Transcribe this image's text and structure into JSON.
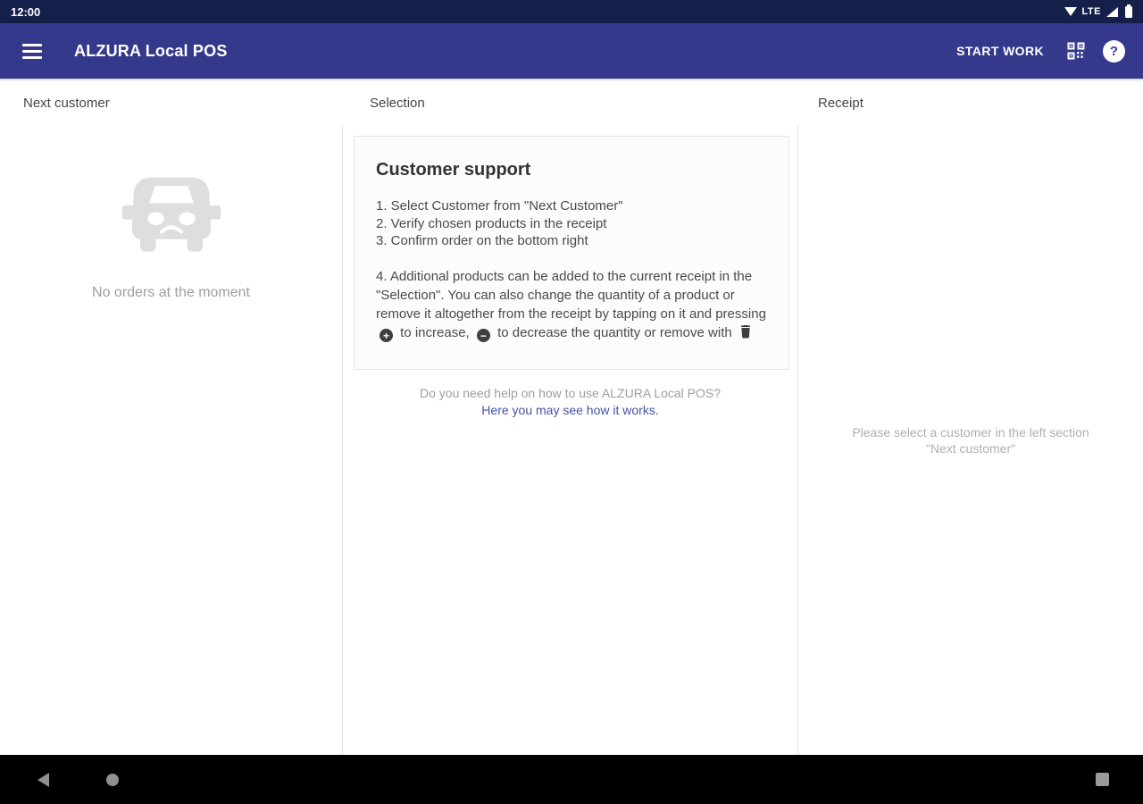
{
  "status_bar": {
    "time": "12:00",
    "network": "LTE"
  },
  "app_bar": {
    "title": "ALZURA Local POS",
    "start_work_label": "START WORK"
  },
  "columns": {
    "next_customer": {
      "header": "Next customer",
      "empty_text": "No orders at the moment"
    },
    "selection": {
      "header": "Selection",
      "card": {
        "title": "Customer support",
        "steps": [
          "1. Select Customer from \"Next Customer\"",
          "2. Verify chosen products in the receipt",
          "3. Confirm order on the bottom right"
        ],
        "step4_intro": "4. Additional products can be added to the current receipt in the \"Selection\". You can also change the quantity of a product or remove it altogether from the receipt by tapping on it and pressing",
        "step4_after_plus": "to increase,",
        "step4_after_minus": "to decrease the quantity or remove with"
      },
      "help_question": "Do you need help on how to use ALZURA Local POS?",
      "help_link": "Here you may see how it works."
    },
    "receipt": {
      "header": "Receipt",
      "empty_line1": "Please select a customer in the left section",
      "empty_line2": "\"Next customer\""
    }
  },
  "icons": {
    "menu": "hamburger-icon",
    "qr": "qr-code-icon",
    "help": "help-icon",
    "wifi": "wifi-icon",
    "signal": "cellular-signal-icon",
    "battery": "battery-icon",
    "car": "sad-car-icon",
    "plus": "add-circle-icon",
    "minus": "remove-circle-icon",
    "trash": "delete-icon",
    "back": "back-icon",
    "home": "home-icon",
    "recents": "recents-icon"
  },
  "colors": {
    "app_bar": "#34398c",
    "status_bar": "#15204a",
    "link": "#4653a2",
    "divider": "#e3e3e3",
    "muted_text": "#9e9e9e"
  }
}
